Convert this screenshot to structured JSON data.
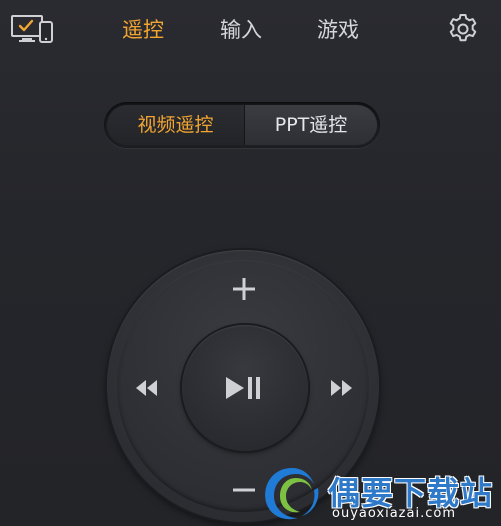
{
  "topbar": {
    "device_icon": "screen-devices-icon",
    "tabs": [
      {
        "label": "遥控",
        "active": true
      },
      {
        "label": "输入",
        "active": false
      },
      {
        "label": "游戏",
        "active": false
      }
    ],
    "settings_icon": "gear-icon"
  },
  "mode_switch": {
    "options": [
      {
        "label": "视频遥控",
        "selected": true
      },
      {
        "label": "PPT遥控",
        "selected": false
      }
    ]
  },
  "remote": {
    "up_icon": "plus-icon",
    "down_icon": "minus-icon",
    "left_icon": "rewind-icon",
    "right_icon": "fast-forward-icon",
    "center_icon": "play-pause-icon"
  },
  "watermark": {
    "title": "偶要下载站",
    "url": "ouyaoxiazai.com"
  },
  "colors": {
    "accent": "#f2a531",
    "background": "#26272c",
    "text": "#d5d6da",
    "watermark_blue": "#2f79c9"
  }
}
